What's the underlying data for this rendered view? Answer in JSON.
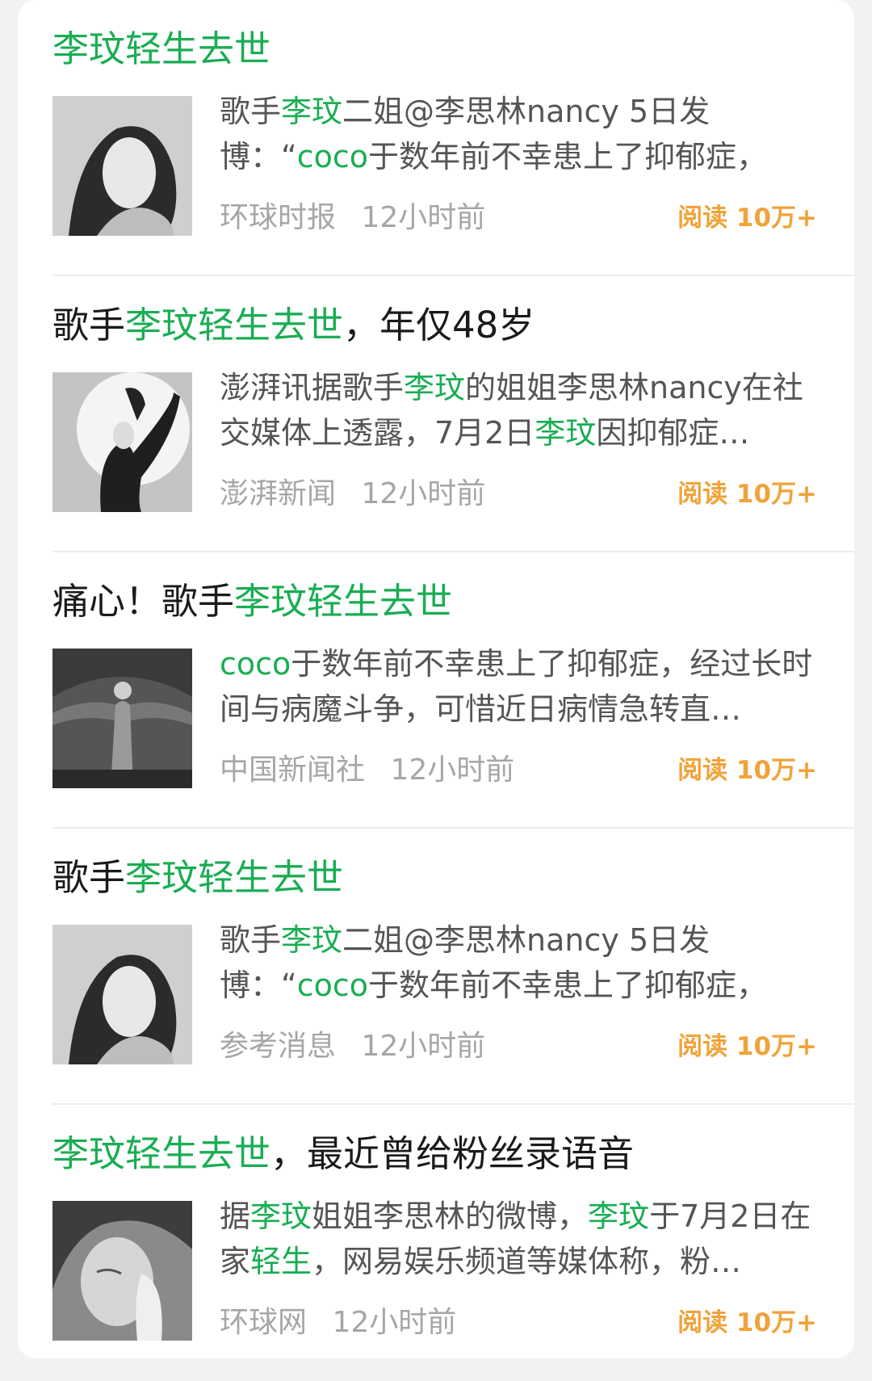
{
  "colors": {
    "highlight": "#1aad53",
    "reads": "#f0a33a",
    "meta": "#a6a6a6",
    "text": "#1a1a1a"
  },
  "articles": [
    {
      "title": [
        {
          "text": "李玟轻生去世",
          "hl": true
        }
      ],
      "summary": [
        {
          "text": "歌手",
          "hl": false
        },
        {
          "text": "李玟",
          "hl": true
        },
        {
          "text": "二姐@李思林nancy 5日发博：“",
          "hl": false
        },
        {
          "text": "coco",
          "hl": true
        },
        {
          "text": "于数年前不幸患上了抑郁症，经…",
          "hl": false
        }
      ],
      "source": "环球时报",
      "time": "12小时前",
      "reads": "阅读 10万+",
      "thumb_icon": "portrait-photo-icon"
    },
    {
      "title": [
        {
          "text": "歌手",
          "hl": false
        },
        {
          "text": "李玟轻生去世",
          "hl": true
        },
        {
          "text": "，年仅48岁",
          "hl": false
        }
      ],
      "summary": [
        {
          "text": "澎湃讯据歌手",
          "hl": false
        },
        {
          "text": "李玟",
          "hl": true
        },
        {
          "text": "的姐姐李思林nancy在社交媒体上透露，7月2日",
          "hl": false
        },
        {
          "text": "李玟",
          "hl": true
        },
        {
          "text": "因抑郁症…",
          "hl": false
        }
      ],
      "source": "澎湃新闻",
      "time": "12小时前",
      "reads": "阅读 10万+",
      "thumb_icon": "performer-photo-icon"
    },
    {
      "title": [
        {
          "text": "痛心！歌手",
          "hl": false
        },
        {
          "text": "李玟轻生去世",
          "hl": true
        }
      ],
      "summary": [
        {
          "text": "coco",
          "hl": true
        },
        {
          "text": "于数年前不幸患上了抑郁症，经过长时间与病魔斗争，可惜近日病情急转直…",
          "hl": false
        }
      ],
      "source": "中国新闻社",
      "time": "12小时前",
      "reads": "阅读 10万+",
      "thumb_icon": "stage-photo-icon"
    },
    {
      "title": [
        {
          "text": "歌手",
          "hl": false
        },
        {
          "text": "李玟轻生去世",
          "hl": true
        }
      ],
      "summary": [
        {
          "text": "歌手",
          "hl": false
        },
        {
          "text": "李玟",
          "hl": true
        },
        {
          "text": "二姐@李思林nancy 5日发博：“",
          "hl": false
        },
        {
          "text": "coco",
          "hl": true
        },
        {
          "text": "于数年前不幸患上了抑郁症，经…",
          "hl": false
        }
      ],
      "source": "参考消息",
      "time": "12小时前",
      "reads": "阅读 10万+",
      "thumb_icon": "portrait-photo-icon"
    },
    {
      "title": [
        {
          "text": "李玟轻生去世",
          "hl": true
        },
        {
          "text": "，最近曾给粉丝录语音",
          "hl": false
        }
      ],
      "summary": [
        {
          "text": "据",
          "hl": false
        },
        {
          "text": "李玟",
          "hl": true
        },
        {
          "text": "姐姐李思林的微博，",
          "hl": false
        },
        {
          "text": "李玟",
          "hl": true
        },
        {
          "text": "于7月2日在家",
          "hl": false
        },
        {
          "text": "轻生",
          "hl": true
        },
        {
          "text": "，网易娱乐频道等媒体称，粉…",
          "hl": false
        }
      ],
      "source": "环球网",
      "time": "12小时前",
      "reads": "阅读 10万+",
      "thumb_icon": "praying-photo-icon"
    }
  ]
}
